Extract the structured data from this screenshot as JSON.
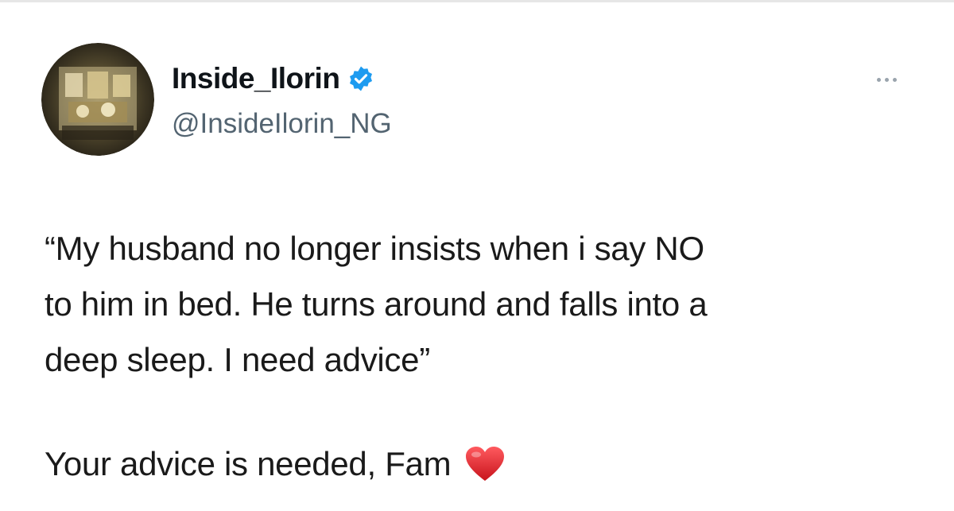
{
  "tweet": {
    "author": {
      "display_name": "Inside_Ilorin",
      "handle": "@InsideIlorin_NG",
      "verified": true,
      "verified_icon": "verified-badge-icon",
      "avatar_icon": "avatar-image"
    },
    "more_icon": "more-horizontal-icon",
    "text_lines": [
      "“My husband no longer insists when i say NO",
      "to him in bed. He turns around and falls into a",
      "deep sleep. I need advice”"
    ],
    "cta_text": "Your advice is needed, Fam",
    "cta_icon": "red-heart-icon"
  },
  "colors": {
    "verified_blue": "#1d9bf0",
    "heart_red": "#e0242d",
    "handle_gray": "#536471",
    "text": "#0f1419"
  }
}
